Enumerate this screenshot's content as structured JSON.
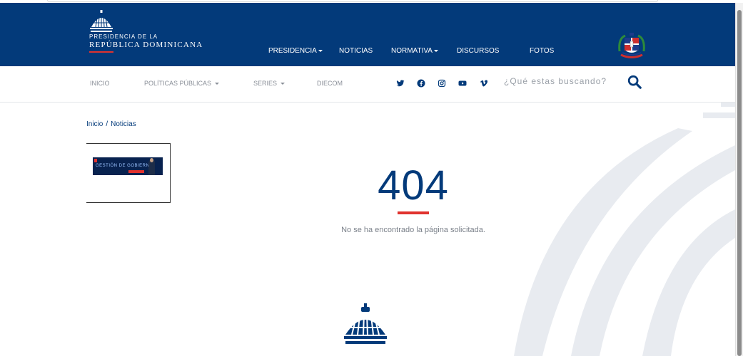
{
  "header": {
    "logo_line1": "PRESIDENCIA DE LA",
    "logo_line2": "REPÚBLICA DOMINICANA",
    "nav": [
      {
        "label": "PRESIDENCIA",
        "has_dropdown": true
      },
      {
        "label": "NOTICIAS",
        "has_dropdown": false
      },
      {
        "label": "NORMATIVA",
        "has_dropdown": true
      },
      {
        "label": "DISCURSOS",
        "has_dropdown": false
      },
      {
        "label": "FOTOS",
        "has_dropdown": false
      }
    ],
    "coat_of_arms_icon": "dominican-coat-of-arms-icon"
  },
  "subnav": {
    "items": [
      {
        "label": "INICIO",
        "has_dropdown": false
      },
      {
        "label": "POLÍTICAS PÚBLICAS",
        "has_dropdown": true
      },
      {
        "label": "SERIES",
        "has_dropdown": true
      },
      {
        "label": "DIECOM",
        "has_dropdown": false
      }
    ],
    "social": [
      "twitter-icon",
      "facebook-icon",
      "instagram-icon",
      "youtube-icon",
      "vimeo-icon"
    ],
    "search_placeholder": "¿Qué estas buscando?",
    "search_icon": "search-icon"
  },
  "breadcrumb": {
    "home": "Inicio",
    "separator": "/",
    "current": "Noticias"
  },
  "banner": {
    "headline": "GESTIÓN DE GOBIERNO"
  },
  "error": {
    "code": "404",
    "message": "No se ha encontrado la página solicitada."
  },
  "colors": {
    "brand_blue": "#033a7a",
    "accent_red": "#e0322e",
    "muted_text": "#7b818a",
    "arc_gray": "#e8ebf0"
  }
}
